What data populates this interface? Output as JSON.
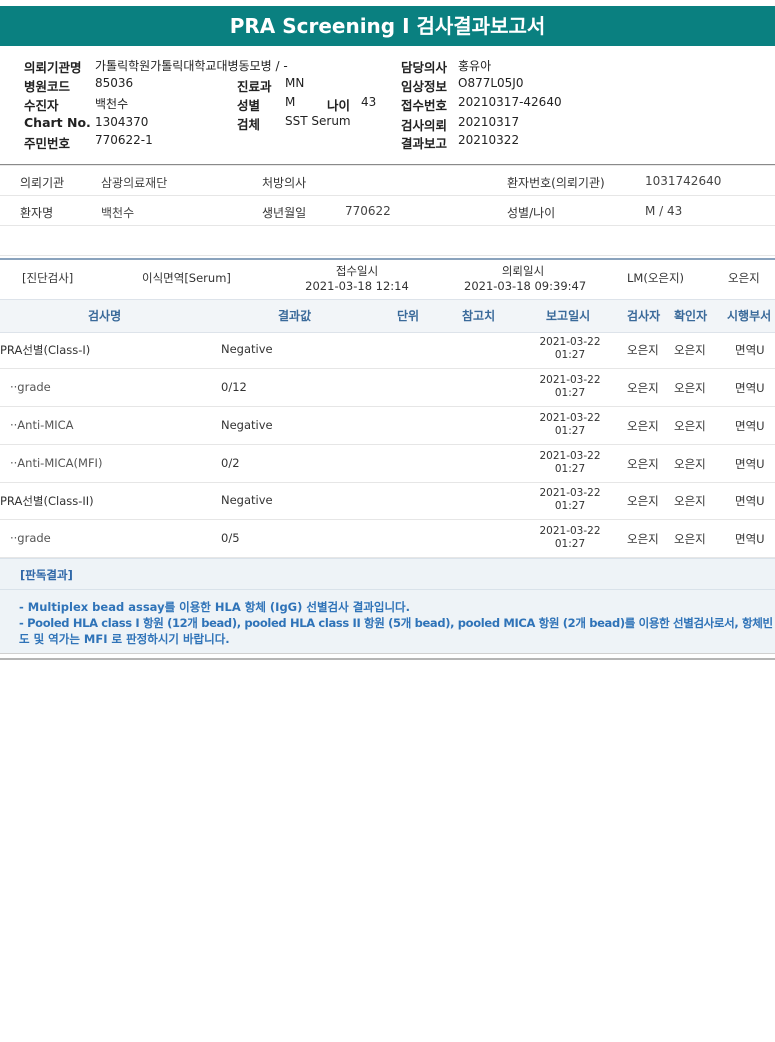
{
  "title": "PRA Screening I 검사결과보고서",
  "header": {
    "institution_label": "의뢰기관명",
    "institution_value": "가톨릭학원가톨릭대학교대병동모병 / -",
    "doctor_label": "담당의사",
    "doctor_value": "홍유아",
    "hospital_code_label": "병원코드",
    "hospital_code_value": "85036",
    "dept_label": "진료과",
    "dept_value": "MN",
    "clinical_label": "임상정보",
    "clinical_value": "O877L05J0",
    "patient_label": "수진자",
    "patient_value": "백천수",
    "sex_label": "성별",
    "sex_value": "M",
    "age_label": "나이",
    "age_value": "43",
    "receipt_label": "접수번호",
    "receipt_value": "20210317-42640",
    "chart_label": "Chart No.",
    "chart_value": "1304370",
    "specimen_label": "검체",
    "specimen_value": "SST Serum",
    "request_label": "검사의뢰",
    "request_value": "20210317",
    "ssn_label": "주민번호",
    "ssn_value": "770622-1",
    "report_label": "결과보고",
    "report_value": "20210322"
  },
  "info": {
    "org_label": "의뢰기관",
    "org_value": "삼광의료재단",
    "presc_label": "처방의사",
    "presc_value": "",
    "pid_label": "환자번호(의뢰기관)",
    "pid_value": "1031742640",
    "name_label": "환자명",
    "name_value": "백천수",
    "dob_label": "생년월일",
    "dob_value": "770622",
    "sexage_label": "성별/나이",
    "sexage_value": "M / 43"
  },
  "exam": {
    "type": "[진단검사]",
    "name": "이식면역[Serum]",
    "recv_label": "접수일시",
    "recv_value": "2021-03-18 12:14",
    "req_label": "의뢰일시",
    "req_value": "2021-03-18 09:39:47",
    "lm": "LM(오은지)",
    "tester": "오은지"
  },
  "table": {
    "headers": [
      "검사명",
      "결과값",
      "단위",
      "참고치",
      "보고일시",
      "검사자",
      "확인자",
      "시행부서"
    ],
    "rows": [
      {
        "name": "PRA선별(Class-I)",
        "result": "Negative",
        "date": "2021-03-22",
        "time": "01:27",
        "tester": "오은지",
        "confirmer": "오은지",
        "dept": "면역U"
      },
      {
        "name": "··grade",
        "result": "0/12",
        "date": "2021-03-22",
        "time": "01:27",
        "tester": "오은지",
        "confirmer": "오은지",
        "dept": "면역U"
      },
      {
        "name": "··Anti-MICA",
        "result": "Negative",
        "date": "2021-03-22",
        "time": "01:27",
        "tester": "오은지",
        "confirmer": "오은지",
        "dept": "면역U"
      },
      {
        "name": "··Anti-MICA(MFI)",
        "result": "0/2",
        "date": "2021-03-22",
        "time": "01:27",
        "tester": "오은지",
        "confirmer": "오은지",
        "dept": "면역U"
      },
      {
        "name": "PRA선별(Class-II)",
        "result": "Negative",
        "date": "2021-03-22",
        "time": "01:27",
        "tester": "오은지",
        "confirmer": "오은지",
        "dept": "면역U"
      },
      {
        "name": "··grade",
        "result": "0/5",
        "date": "2021-03-22",
        "time": "01:27",
        "tester": "오은지",
        "confirmer": "오은지",
        "dept": "면역U"
      }
    ]
  },
  "judgement": {
    "header": "[판독결과]",
    "line1": "- Multiplex bead assay를 이용한 HLA 항체 (IgG) 선별검사 결과입니다.",
    "line2": "- Pooled HLA class I 항원 (12개 bead), pooled HLA class II 항원 (5개 bead), pooled MICA 항원 (2개 bead)를 이용한 선별검사로서, 항체빈",
    "line3": "도 및 역가는 MFI 로 판정하시기 바랍니다."
  }
}
